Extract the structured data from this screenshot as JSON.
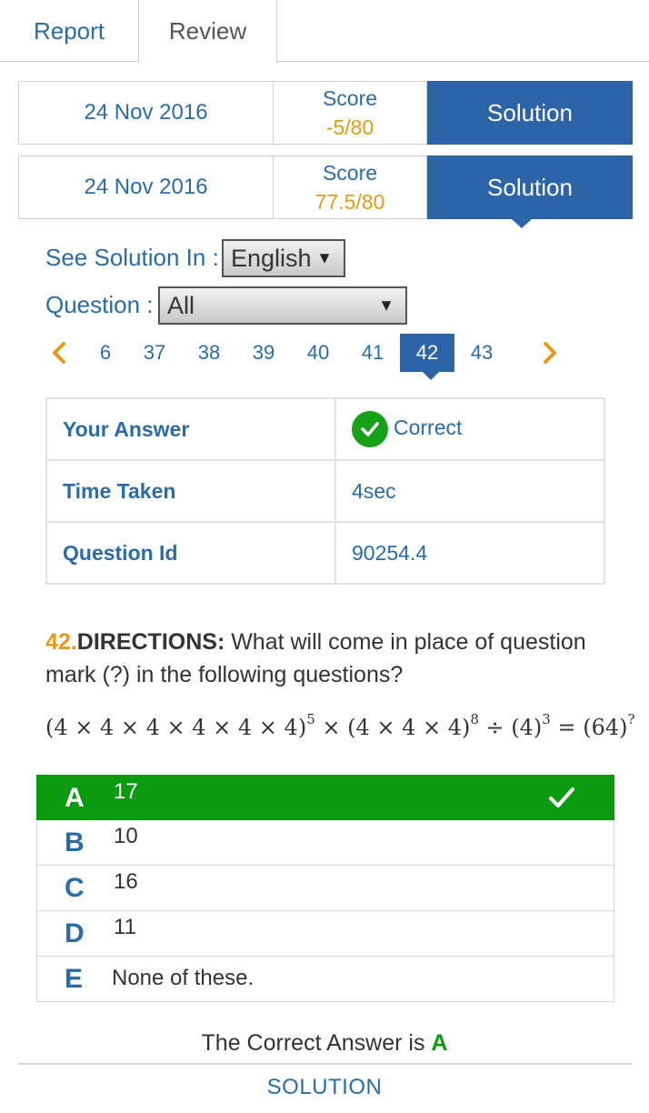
{
  "tabs": {
    "report": "Report",
    "review": "Review"
  },
  "attempts": [
    {
      "date": "24 Nov 2016",
      "score_label": "Score",
      "score": "-5/80",
      "solution_label": "Solution"
    },
    {
      "date": "24 Nov 2016",
      "score_label": "Score",
      "score": "77.5/80",
      "solution_label": "Solution"
    }
  ],
  "language": {
    "label": "See Solution In :",
    "selected": "English"
  },
  "question_filter": {
    "label": "Question :",
    "selected": "All"
  },
  "pager": {
    "numbers": [
      "6",
      "37",
      "38",
      "39",
      "40",
      "41",
      "42",
      "43"
    ],
    "active": "42"
  },
  "stats": {
    "your_answer_label": "Your Answer",
    "your_answer": "Correct",
    "time_label": "Time Taken",
    "time": "4sec",
    "qid_label": "Question Id",
    "qid": "90254.4"
  },
  "question": {
    "number": "42.",
    "directions_label": "DIRECTIONS:",
    "text": " What will come in place of question mark (?) in the following questions?",
    "equation": {
      "part1": "(4 × 4 × 4 × 4 × 4 × 4)",
      "exp1": "5",
      "part2": " × (4 × 4 × 4)",
      "exp2": "8",
      "part3": " ÷ (4)",
      "exp3": "3",
      "part4": " = (64)",
      "exp4": "?"
    }
  },
  "options": [
    {
      "letter": "A",
      "text": "17"
    },
    {
      "letter": "B",
      "text": "10"
    },
    {
      "letter": "C",
      "text": "16"
    },
    {
      "letter": "D",
      "text": "11"
    },
    {
      "letter": "E",
      "text": "None of these."
    }
  ],
  "correct": {
    "prefix": "The Correct Answer is ",
    "letter": "A"
  },
  "solution_link": "SOLUTION",
  "colors": {
    "accent": "#2d64a8",
    "text_blue": "#2a6ca8",
    "orange": "#e39c16",
    "green": "#0c9a10"
  }
}
